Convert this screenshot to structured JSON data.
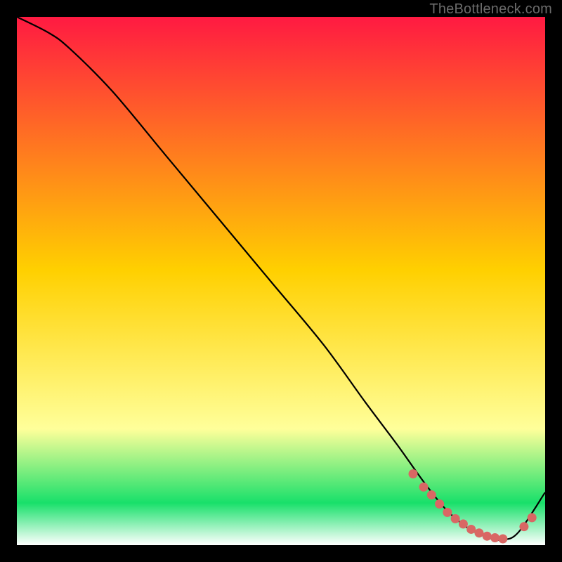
{
  "watermark": "TheBottleneck.com",
  "colors": {
    "bg": "#000000",
    "grad_top": "#ff1a42",
    "grad_mid": "#ffd000",
    "grad_low": "#ffff9a",
    "grad_green": "#18e06a",
    "grad_bottom": "#ffffff",
    "curve": "#000000",
    "marker_fill": "#d96764",
    "marker_stroke": "#d96764",
    "watermark": "#6b6b6b"
  },
  "chart_data": {
    "type": "line",
    "title": "",
    "xlabel": "",
    "ylabel": "",
    "xlim": [
      0,
      100
    ],
    "ylim": [
      0,
      100
    ],
    "series": [
      {
        "name": "curve",
        "x": [
          0,
          6,
          10,
          18,
          28,
          38,
          48,
          58,
          66,
          72,
          77,
          81,
          85,
          89,
          92,
          95,
          100
        ],
        "y": [
          100,
          97,
          94,
          86,
          74,
          62,
          50,
          38,
          27,
          19,
          12,
          7,
          3.5,
          1.5,
          1,
          2.5,
          10
        ]
      }
    ],
    "markers": {
      "name": "highlighted-points",
      "x": [
        75,
        77,
        78.5,
        80,
        81.5,
        83,
        84.5,
        86,
        87.5,
        89,
        90.5,
        92,
        96,
        97.5
      ],
      "y": [
        13.5,
        11,
        9.5,
        7.8,
        6.2,
        5,
        4,
        3,
        2.3,
        1.7,
        1.4,
        1.2,
        3.5,
        5.2
      ]
    }
  }
}
